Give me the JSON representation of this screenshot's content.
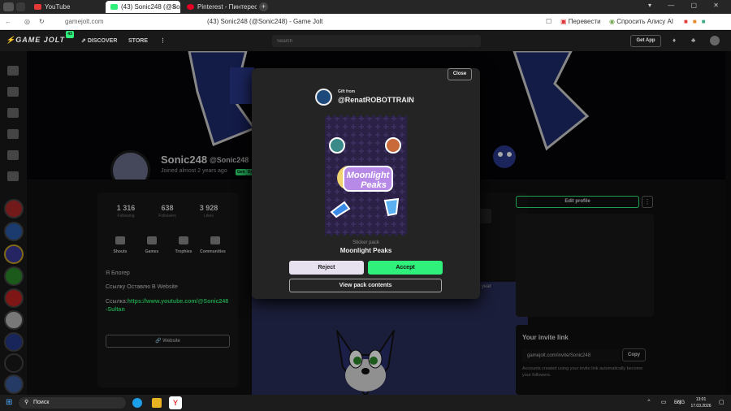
{
  "browser": {
    "tabs": [
      {
        "label": "YouTube"
      },
      {
        "label": "(43) Sonic248 (@Sonic"
      },
      {
        "label": "Pinterest - Пинтерест"
      }
    ],
    "address": "gamejolt.com",
    "page_title": "(43) Sonic248 (@Sonic248) - Game Jolt",
    "translate_label": "Перевести",
    "ask_label": "Спросить Алису AI"
  },
  "gamejolt": {
    "logo": "GAME JOLT",
    "logo_badge": "43",
    "nav": {
      "discover": "DISCOVER",
      "store": "STORE"
    },
    "search_placeholder": "Search",
    "get_app": "Get App"
  },
  "profile": {
    "name": "Sonic248",
    "handle": "@Sonic248",
    "joined": "Joined almost 2 years ago",
    "badges": [
      "Gen",
      "Dev"
    ],
    "stats": [
      {
        "value": "1 316",
        "label": "Following"
      },
      {
        "value": "638",
        "label": "Followers"
      },
      {
        "value": "3 928",
        "label": "Likes"
      }
    ],
    "links": [
      "Shouts",
      "Games",
      "Trophies",
      "Communities"
    ],
    "bio_lines": [
      "Я Блогер",
      "Ссылку Оставлю В Website"
    ],
    "bio_link_prefix": "Ссылка:",
    "bio_link_url": "https://www.youtube.com/@Sonic248",
    "bio_link_suffix": "-Sultan",
    "website_button": "Website",
    "edit_profile": "Edit profile",
    "post_time_fragment": "1 year"
  },
  "invite": {
    "title": "Your invite link",
    "link": "gamejolt.com/invite/Sonic248",
    "copy": "Copy",
    "description": "Accounts created using your invite link automatically become your followers."
  },
  "modal": {
    "close": "Close",
    "gift_from": "Gift from",
    "sender": "@RenatROBOTTRAIN",
    "pack_type": "Sticker pack",
    "pack_name": "Moonlight Peaks",
    "art_text_1": "Moonlight",
    "art_text_2": "Peaks",
    "reject": "Reject",
    "accept": "Accept",
    "view_contents": "View pack contents"
  },
  "taskbar": {
    "search": "Поиск",
    "lang": "ENG",
    "time": "13:01",
    "date": "17.03.2026"
  },
  "colors": {
    "accent_green": "#2ef07b",
    "link_green": "#2ee86c",
    "modal_bg": "#242424",
    "pack_purple": "#2b2146"
  }
}
